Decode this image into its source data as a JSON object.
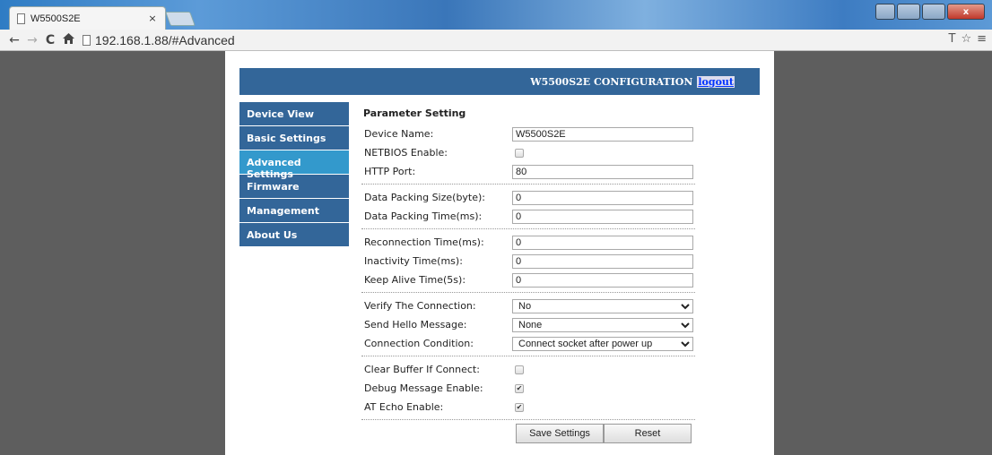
{
  "browser": {
    "tab_title": "W5500S2E",
    "tab_close": "×",
    "url": "192.168.1.88/#Advanced",
    "window_close": "x"
  },
  "icons": {
    "back": "←",
    "forward": "→",
    "reload": "C",
    "home": "🏠",
    "bookmark": "☆",
    "menu": "≡",
    "translate": "T"
  },
  "header": {
    "title": "W5500S2E CONFIGURATION",
    "logout": "logout"
  },
  "sidebar": {
    "items": [
      {
        "label": "Device View"
      },
      {
        "label": "Basic Settings"
      },
      {
        "label": "Advanced Settings"
      },
      {
        "label": "Firmware"
      },
      {
        "label": "Management"
      },
      {
        "label": "About Us"
      }
    ],
    "active": "Advanced Settings"
  },
  "form": {
    "title": "Parameter Setting",
    "device_name": {
      "label": "Device Name:",
      "value": "W5500S2E"
    },
    "netbios": {
      "label": "NETBIOS Enable:",
      "checked": false
    },
    "http_port": {
      "label": "HTTP Port:",
      "value": "80"
    },
    "packing_size": {
      "label": "Data Packing Size(byte):",
      "value": "0"
    },
    "packing_time": {
      "label": "Data Packing Time(ms):",
      "value": "0"
    },
    "reconnection_time": {
      "label": "Reconnection Time(ms):",
      "value": "0"
    },
    "inactivity_time": {
      "label": "Inactivity Time(ms):",
      "value": "0"
    },
    "keep_alive": {
      "label": "Keep Alive Time(5s):",
      "value": "0"
    },
    "verify_connection": {
      "label": "Verify The Connection:",
      "value": "No"
    },
    "hello_message": {
      "label": "Send Hello Message:",
      "value": "None"
    },
    "connection_condition": {
      "label": "Connection Condition:",
      "value": "Connect socket after power up"
    },
    "clear_buffer": {
      "label": "Clear Buffer If Connect:",
      "checked": false
    },
    "debug_message": {
      "label": "Debug Message Enable:",
      "checked": true
    },
    "at_echo": {
      "label": "AT Echo Enable:",
      "checked": true
    },
    "checkmark": "✔",
    "save_label": "Save Settings",
    "reset_label": "Reset"
  },
  "colors": {
    "header_bg": "#336699",
    "sidebar_bg": "#336699",
    "sidebar_active": "#3399cc",
    "outer_bg": "#5e5e5e"
  }
}
